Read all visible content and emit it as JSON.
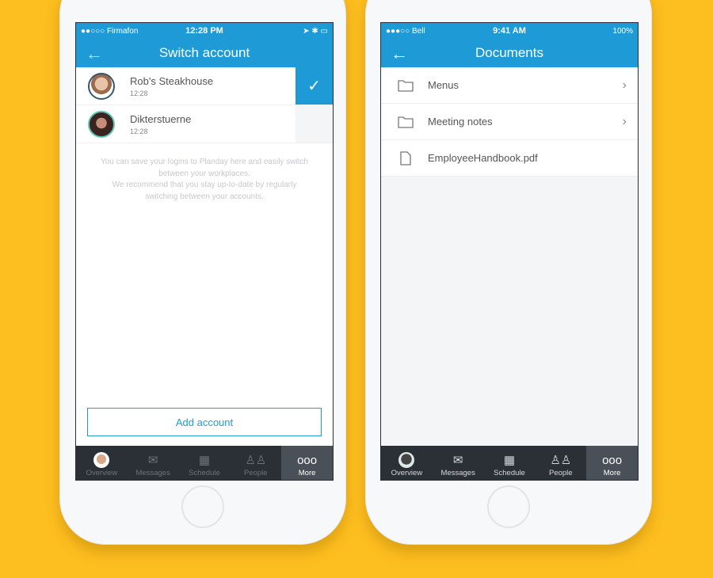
{
  "colors": {
    "background": "#FDBE1F",
    "accent": "#1E9BD7",
    "tabbar": "#2B3036"
  },
  "left": {
    "status": {
      "carrier": "●●○○○ Firmafon",
      "time": "12:28 PM",
      "right": "➤ ✱ ▭"
    },
    "title": "Switch account",
    "accounts": [
      {
        "name": "Rob's Steakhouse",
        "time": "12:28",
        "selected": true
      },
      {
        "name": "Dikterstuerne",
        "time": "12:28",
        "selected": false
      }
    ],
    "info1": "You can save your logins to Planday here and easily switch between your workplaces.",
    "info2": "We recommend that you stay up-to-date by regularly switching between your accounts.",
    "add_account": "Add account",
    "tabs": [
      "Overview",
      "Messages",
      "Schedule",
      "People",
      "More"
    ],
    "active_tab": "More"
  },
  "right": {
    "status": {
      "carrier": "●●●○○ Bell",
      "time": "9:41 AM",
      "right": "100%"
    },
    "title": "Documents",
    "items": [
      {
        "name": "Menus",
        "type": "folder"
      },
      {
        "name": "Meeting notes",
        "type": "folder"
      },
      {
        "name": "EmployeeHandbook.pdf",
        "type": "file"
      }
    ],
    "tabs": [
      "Overview",
      "Messages",
      "Schedule",
      "People",
      "More"
    ],
    "active_tab": "More"
  }
}
